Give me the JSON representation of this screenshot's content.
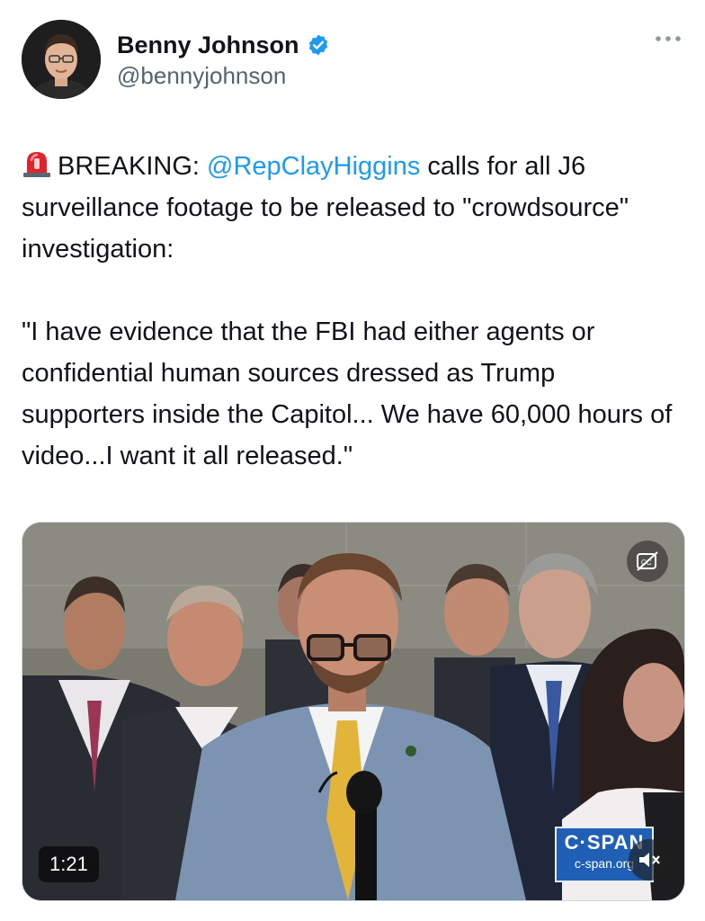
{
  "author": {
    "display_name": "Benny Johnson",
    "handle": "@bennyjohnson",
    "verified_icon": "verified-badge-icon",
    "avatar_icon": "avatar"
  },
  "menu": {
    "icon": "more-icon"
  },
  "tweet": {
    "siren_icon": "siren-emoji",
    "line1_prefix": "BREAKING: ",
    "mention": "@RepClayHiggins",
    "line1_suffix": " calls for all J6 surveillance footage to be released to \"crowdsource\" investigation:",
    "quote": "\"I have evidence that the FBI had either agents or confidential human sources dressed as Trump supporters inside the Capitol... We have 60,000 hours of video...I want it all released.\""
  },
  "media": {
    "duration": "1:21",
    "network_logo": "C·SPAN",
    "network_url": "c-span.org",
    "captions_icon": "captions-off-icon",
    "mute_icon": "muted-speaker-icon"
  },
  "colors": {
    "accent": "#1d9bf0",
    "text": "#0f1419",
    "secondary_text": "#536471",
    "cspan_blue": "#1f5fb5"
  }
}
